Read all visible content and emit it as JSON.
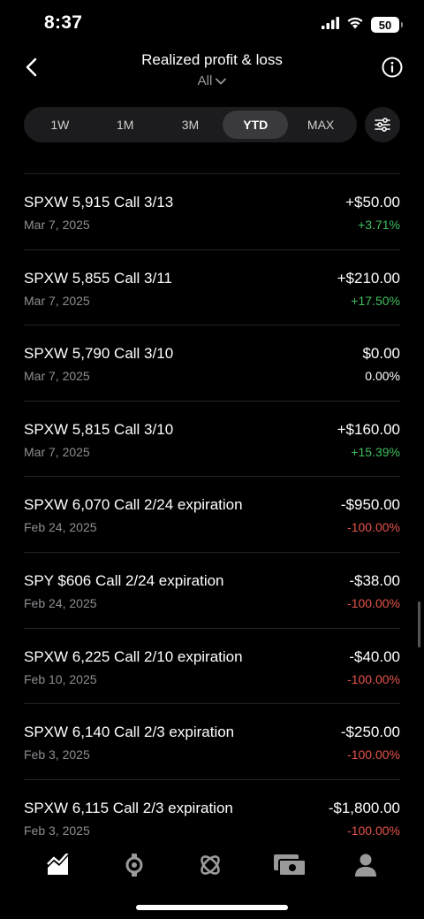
{
  "status": {
    "time": "8:37",
    "battery": "50"
  },
  "header": {
    "title": "Realized profit & loss",
    "filter_label": "All"
  },
  "range": {
    "tabs": [
      {
        "label": "1W"
      },
      {
        "label": "1M"
      },
      {
        "label": "3M"
      },
      {
        "label": "YTD"
      },
      {
        "label": "MAX"
      }
    ],
    "active": "YTD"
  },
  "colors": {
    "positive": "#3fbf5f",
    "negative": "#e5534b",
    "neutral": "#ffffff"
  },
  "items": [
    {
      "name": "SPXW 5,915 Call 3/13",
      "date": "Mar 7, 2025",
      "amount": "+$50.00",
      "pct": "+3.71%",
      "tone": "positive"
    },
    {
      "name": "SPXW 5,855 Call 3/11",
      "date": "Mar 7, 2025",
      "amount": "+$210.00",
      "pct": "+17.50%",
      "tone": "positive"
    },
    {
      "name": "SPXW 5,790 Call 3/10",
      "date": "Mar 7, 2025",
      "amount": "$0.00",
      "pct": "0.00%",
      "tone": "neutral"
    },
    {
      "name": "SPXW 5,815 Call 3/10",
      "date": "Mar 7, 2025",
      "amount": "+$160.00",
      "pct": "+15.39%",
      "tone": "positive"
    },
    {
      "name": "SPXW 6,070 Call 2/24 expiration",
      "date": "Feb 24, 2025",
      "amount": "-$950.00",
      "pct": "-100.00%",
      "tone": "negative"
    },
    {
      "name": "SPY $606 Call 2/24 expiration",
      "date": "Feb 24, 2025",
      "amount": "-$38.00",
      "pct": "-100.00%",
      "tone": "negative"
    },
    {
      "name": "SPXW 6,225 Call 2/10 expiration",
      "date": "Feb 10, 2025",
      "amount": "-$40.00",
      "pct": "-100.00%",
      "tone": "negative"
    },
    {
      "name": "SPXW 6,140 Call 2/3 expiration",
      "date": "Feb 3, 2025",
      "amount": "-$250.00",
      "pct": "-100.00%",
      "tone": "negative"
    },
    {
      "name": "SPXW 6,115 Call 2/3 expiration",
      "date": "Feb 3, 2025",
      "amount": "-$1,800.00",
      "pct": "-100.00%",
      "tone": "negative"
    }
  ],
  "tabbar": {
    "icons": [
      "investing-chart-icon",
      "crypto-icon",
      "network-icon",
      "cash-icon",
      "account-icon"
    ]
  }
}
